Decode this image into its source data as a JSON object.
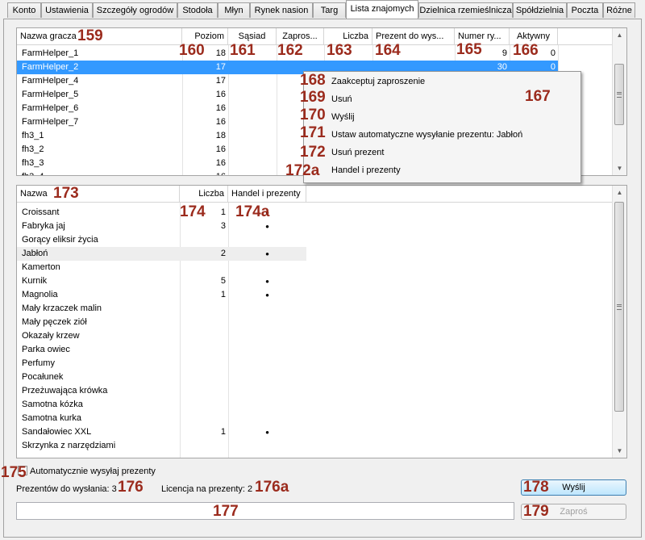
{
  "tabs": [
    "Konto",
    "Ustawienia",
    "Szczegóły ogrodów",
    "Stodoła",
    "Młyn",
    "Rynek nasion",
    "Targ",
    "Lista znajomych",
    "Dzielnica rzemieślnicza",
    "Spółdzielnia",
    "Poczta",
    "Różne"
  ],
  "active_tab": "Lista znajomych",
  "friends_table": {
    "columns": [
      "Nazwa gracza",
      "Poziom",
      "Sąsiad",
      "Zapros...",
      "Liczba",
      "Prezent do wys...",
      "Numer ry...",
      "Aktywny"
    ],
    "rows": [
      {
        "name": "FarmHelper_1",
        "level": "18",
        "number": "9",
        "active": "0"
      },
      {
        "name": "FarmHelper_2",
        "level": "17",
        "number": "30",
        "active": "0"
      },
      {
        "name": "FarmHelper_4",
        "level": "17",
        "number": "",
        "active": ""
      },
      {
        "name": "FarmHelper_5",
        "level": "16",
        "number": "",
        "active": ""
      },
      {
        "name": "FarmHelper_6",
        "level": "16",
        "number": "",
        "active": ""
      },
      {
        "name": "FarmHelper_7",
        "level": "16",
        "number": "",
        "active": ""
      },
      {
        "name": "fh3_1",
        "level": "18",
        "number": "",
        "active": ""
      },
      {
        "name": "fh3_2",
        "level": "16",
        "number": "",
        "active": ""
      },
      {
        "name": "fh3_3",
        "level": "16",
        "number": "",
        "active": ""
      },
      {
        "name": "fh3_4",
        "level": "16",
        "number": "",
        "active": ""
      }
    ],
    "selected_row": 1
  },
  "context_menu": {
    "items": [
      "Zaakceptuj zaproszenie",
      "Usuń",
      "Wyślij",
      "Ustaw automatyczne wysyłanie prezentu: Jabłoń",
      "Usuń prezent",
      "Handel i prezenty"
    ]
  },
  "items_table": {
    "columns": [
      "Nazwa",
      "Liczba",
      "Handel i prezenty"
    ],
    "rows": [
      {
        "name": "Croissant",
        "count": "1",
        "mark": "•"
      },
      {
        "name": "Fabryka jaj",
        "count": "3",
        "mark": "•"
      },
      {
        "name": "Gorący eliksir życia",
        "count": "",
        "mark": ""
      },
      {
        "name": "Jabłoń",
        "count": "2",
        "mark": "•"
      },
      {
        "name": "Kamerton",
        "count": "",
        "mark": ""
      },
      {
        "name": "Kurnik",
        "count": "5",
        "mark": "•"
      },
      {
        "name": "Magnolia",
        "count": "1",
        "mark": "•"
      },
      {
        "name": "Mały krzaczek malin",
        "count": "",
        "mark": ""
      },
      {
        "name": "Mały pęczek ziół",
        "count": "",
        "mark": ""
      },
      {
        "name": "Okazały krzew",
        "count": "",
        "mark": ""
      },
      {
        "name": "Parka owiec",
        "count": "",
        "mark": ""
      },
      {
        "name": "Perfumy",
        "count": "",
        "mark": ""
      },
      {
        "name": "Pocałunek",
        "count": "",
        "mark": ""
      },
      {
        "name": "Przeżuwająca krówka",
        "count": "",
        "mark": ""
      },
      {
        "name": "Samotna kózka",
        "count": "",
        "mark": ""
      },
      {
        "name": "Samotna kurka",
        "count": "",
        "mark": ""
      },
      {
        "name": "Sandałowiec XXL",
        "count": "1",
        "mark": "•"
      },
      {
        "name": "Skrzynka z narzędziami",
        "count": "",
        "mark": ""
      },
      {
        "name": "",
        "count": "",
        "mark": ""
      }
    ],
    "highlighted_row": 3
  },
  "bottom": {
    "auto_send_label": "Automatycznie wysyłaj prezenty",
    "gifts_to_send_label": "Prezentów do wysłania:",
    "gifts_to_send_value": "3",
    "license_label": "Licencja na prezenty:",
    "license_value": "2",
    "message_value": "",
    "send_button": "Wyślij",
    "invite_button": "Zaproś"
  },
  "annotations": {
    "a159": "159",
    "a160": "160",
    "a161": "161",
    "a162": "162",
    "a163": "163",
    "a164": "164",
    "a165": "165",
    "a166": "166",
    "a167": "167",
    "a168": "168",
    "a169": "169",
    "a170": "170",
    "a171": "171",
    "a172": "172",
    "a172a": "172a",
    "a173": "173",
    "a174": "174",
    "a174a": "174a",
    "a175": "175",
    "a176": "176",
    "a176a": "176a",
    "a177": "177",
    "a178": "178",
    "a179": "179"
  },
  "colors": {
    "selection": "#3399ff",
    "annotation": "#9b2b1d"
  }
}
